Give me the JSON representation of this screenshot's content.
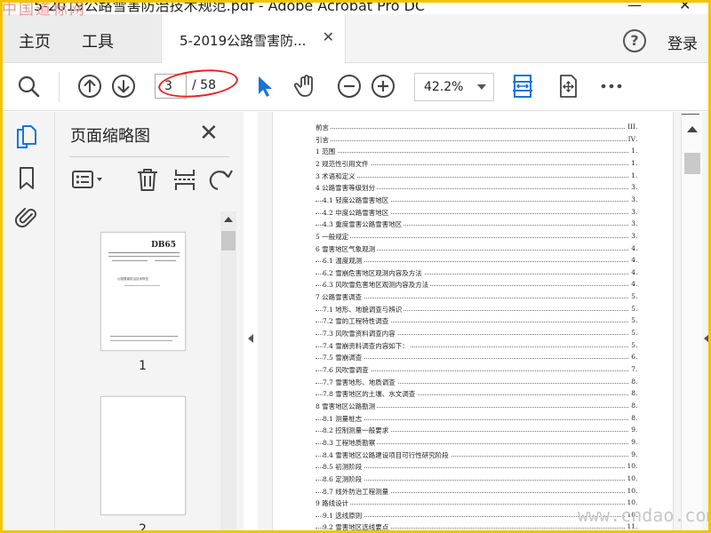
{
  "window": {
    "title": "5-2019公路雪害防治技术规范.pdf - Adobe Acrobat Pro DC",
    "minimize": "—",
    "close": "✕"
  },
  "watermarks": {
    "top_left": "中国道标网",
    "bottom_right": "www.cndao.com"
  },
  "menu": {
    "home": "主页",
    "tools": "工具"
  },
  "tab": {
    "label": "5-2019公路雪害防...",
    "close": "✕"
  },
  "header": {
    "help": "?",
    "login": "登录"
  },
  "toolbar": {
    "current_page": "3",
    "page_total": "/ 58",
    "zoom": "42.2%"
  },
  "panel": {
    "title": "页面缩略图",
    "close": "✕",
    "thumbnails": [
      {
        "page_label": "1",
        "badge": "DB65",
        "doc_title": "公路雪害防治技术规范"
      },
      {
        "page_label": "2"
      }
    ]
  },
  "toc": [
    {
      "text": "前言",
      "page": "III",
      "indent": 0
    },
    {
      "text": "引言",
      "page": "IV",
      "indent": 0
    },
    {
      "text": "1  范围",
      "page": "1",
      "indent": 0
    },
    {
      "text": "2  规范性引用文件",
      "page": "1",
      "indent": 0
    },
    {
      "text": "3  术语和定义",
      "page": "1",
      "indent": 0
    },
    {
      "text": "4  公路雪害等级划分",
      "page": "3",
      "indent": 0
    },
    {
      "text": "4.1  轻度公路雪害地区",
      "page": "3",
      "indent": 1
    },
    {
      "text": "4.2  中度公路雪害地区",
      "page": "3",
      "indent": 1
    },
    {
      "text": "4.3  重度雪害公路雪害地区",
      "page": "3",
      "indent": 1
    },
    {
      "text": "5  一般规定",
      "page": "3",
      "indent": 0
    },
    {
      "text": "6  雪害地区气象观测",
      "page": "4",
      "indent": 0
    },
    {
      "text": "6.1  温度观测",
      "page": "4",
      "indent": 1
    },
    {
      "text": "6.2  雪崩危害地区观测内容及方法",
      "page": "4",
      "indent": 1
    },
    {
      "text": "6.3  风吹雪危害地区观测内容及方法",
      "page": "4",
      "indent": 1
    },
    {
      "text": "7  公路雪害调查",
      "page": "5",
      "indent": 0
    },
    {
      "text": "7.1  地形、地貌调查与辨识",
      "page": "5",
      "indent": 1
    },
    {
      "text": "7.2  雪的工程特性调查",
      "page": "5",
      "indent": 1
    },
    {
      "text": "7.3  风吹雪资料调查内容",
      "page": "5",
      "indent": 1
    },
    {
      "text": "7.4  雪崩资料调查内容如下：",
      "page": "5",
      "indent": 1
    },
    {
      "text": "7.5  雪崩调查",
      "page": "6",
      "indent": 1
    },
    {
      "text": "7.6  风吹雪调查",
      "page": "7",
      "indent": 1
    },
    {
      "text": "7.7  雪害地形、地质调查",
      "page": "8",
      "indent": 1
    },
    {
      "text": "7.8  雪害地区的土壤、水文调查",
      "page": "8",
      "indent": 1
    },
    {
      "text": "8  雪害地区公路勘测",
      "page": "8",
      "indent": 0
    },
    {
      "text": "8.1  测量桩志",
      "page": "8",
      "indent": 1
    },
    {
      "text": "8.2  控制测量一般要求",
      "page": "9",
      "indent": 1
    },
    {
      "text": "8.3  工程地质勘察",
      "page": "9",
      "indent": 1
    },
    {
      "text": "8.4  雪害地区公路建设项目可行性研究阶段",
      "page": "9",
      "indent": 1
    },
    {
      "text": "8.5  初测阶段",
      "page": "10",
      "indent": 1
    },
    {
      "text": "8.6  定测阶段",
      "page": "10",
      "indent": 1
    },
    {
      "text": "8.7  线外防治工程测量",
      "page": "10",
      "indent": 1
    },
    {
      "text": "9  路线设计",
      "page": "10",
      "indent": 0
    },
    {
      "text": "9.1  选线原则",
      "page": "10",
      "indent": 1
    },
    {
      "text": "9.2  雪害地区选线要点",
      "page": "11",
      "indent": 1
    }
  ]
}
